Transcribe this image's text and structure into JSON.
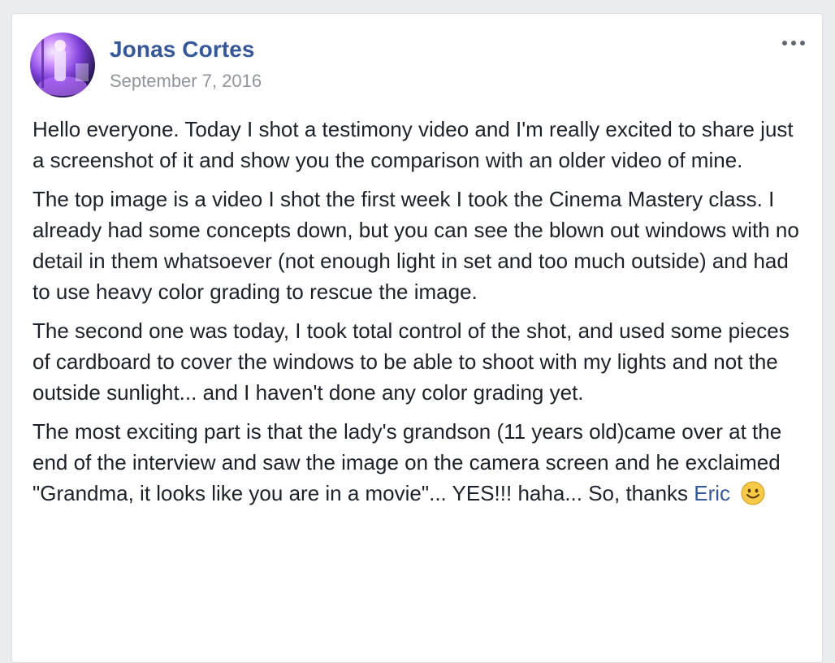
{
  "post": {
    "author": "Jonas Cortes",
    "date": "September 7, 2016",
    "more_label": "More options",
    "paragraphs": [
      "Hello everyone. Today I shot a testimony video and I'm really excited to share just a screenshot of it and show you the comparison with an older video of mine.",
      "The top image is a video I shot the first week I took the Cinema Mastery class. I already had some concepts down, but you can see the blown out windows with no detail in them whatsoever (not enough light in set and too much outside) and had to use heavy color grading to rescue the image.",
      "The second one was today, I took total control of the shot, and used some pieces of cardboard to cover the windows to be able to shoot with my lights and not the outside sunlight... and I haven't done any color grading yet.",
      "The most exciting part is that the lady's grandson (11 years old)came over at the end of the interview and saw the image on the camera screen and he exclaimed \"Grandma, it looks like you are in a movie\"... YES!!! haha... So, thanks"
    ],
    "mention": "Eric",
    "emoji_icon": "smiley-emoji-icon"
  },
  "colors": {
    "link": "#365899",
    "text": "#1d2129",
    "meta": "#90949c",
    "background": "#e9ebee"
  }
}
